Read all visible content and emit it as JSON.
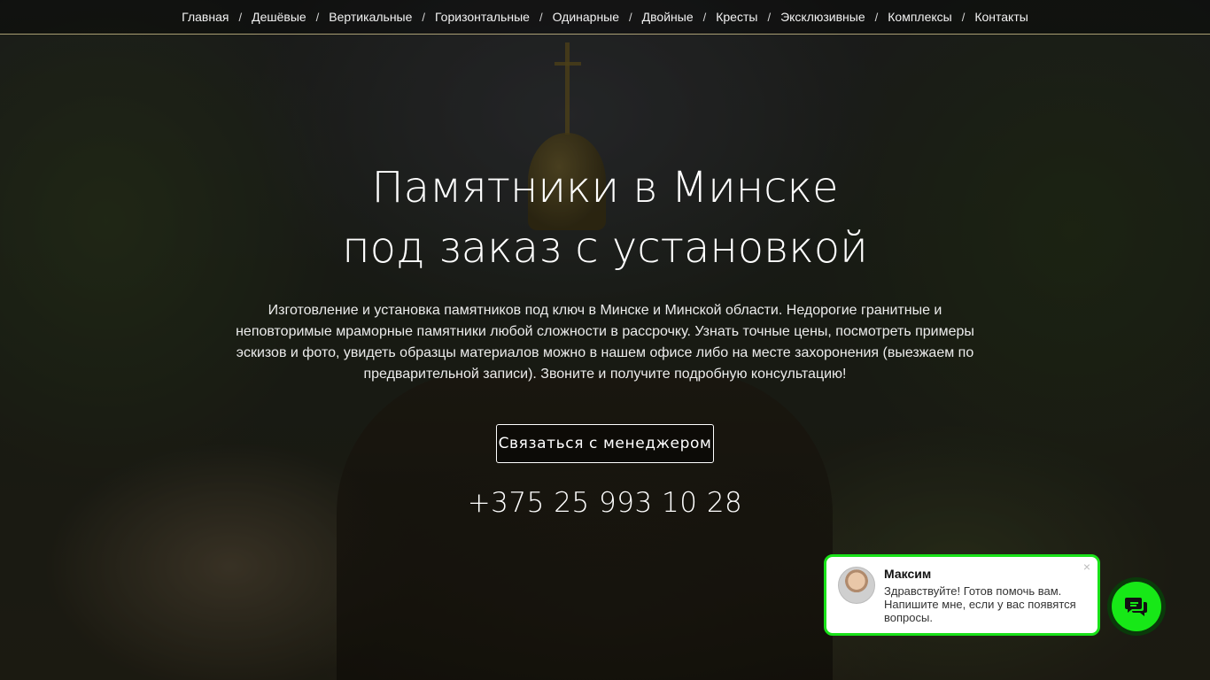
{
  "nav": {
    "items": [
      "Главная",
      "Дешёвые",
      "Вертикальные",
      "Горизонтальные",
      "Одинарные",
      "Двойные",
      "Кресты",
      "Эксклюзивные",
      "Комплексы",
      "Контакты"
    ],
    "separator": "/"
  },
  "hero": {
    "title_line1": "Памятники в Минске",
    "title_line2": "под заказ с установкой",
    "description": "Изготовление и установка памятников под ключ в Минске и Минской области. Недорогие гранитные и неповторимые мраморные памятники любой сложности в рассрочку. Узнать точные цены, посмотреть примеры эскизов и фото, увидеть образцы материалов можно в нашем офисе либо на месте захоронения (выезжаем по предварительной записи). Звоните и получите подробную консультацию!",
    "cta_label": "Связаться с менеджером",
    "phone": "+375 25 993 10 28"
  },
  "chat": {
    "agent_name": "Максим",
    "message": "Здравствуйте! Готов помочь вам. Напишите мне, если у вас появятся вопросы.",
    "close_icon": "×",
    "accent_color": "#19e219",
    "button_icon": "chat-bubbles-icon"
  }
}
